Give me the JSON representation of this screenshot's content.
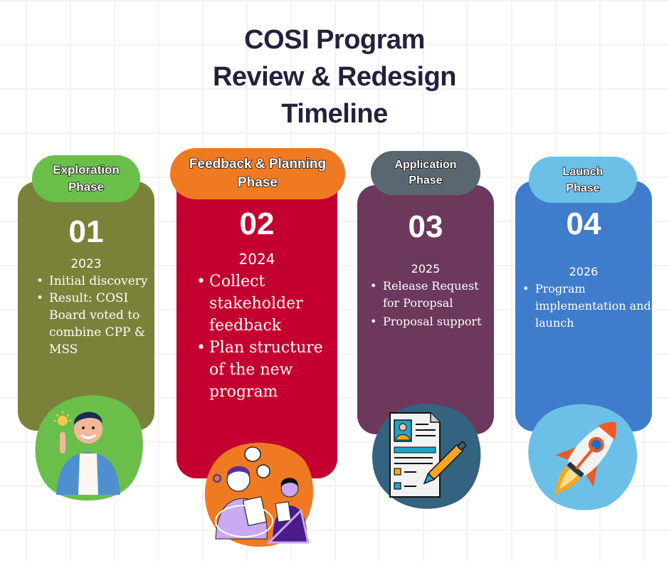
{
  "title": {
    "line1": "COSI Program",
    "line2": "Review & Redesign",
    "line3": "Timeline"
  },
  "phases": [
    {
      "pill_line1": "Exploration",
      "pill_line2": "Phase",
      "number": "01",
      "year": "2023",
      "bullets": [
        "Initial discovery",
        "Result: COSI Board voted to combine CPP & MSS"
      ],
      "card_color": "#7a823a",
      "pill_color": "#6abf4b",
      "illustration": "idea-person-icon"
    },
    {
      "pill_line1": "Feedback & Planning",
      "pill_line2": "Phase",
      "number": "02",
      "year": "2024",
      "bullets": [
        "Collect stakeholder feedback",
        "Plan structure of the new program"
      ],
      "card_color": "#c3002f",
      "pill_color": "#f07a22",
      "illustration": "discussion-people-icon"
    },
    {
      "pill_line1": "Application",
      "pill_line2": "Phase",
      "number": "03",
      "year": "2025",
      "bullets": [
        "Release Request for Poropsal",
        "Proposal support"
      ],
      "card_color": "#6c385c",
      "pill_color": "#5b6770",
      "illustration": "application-form-icon"
    },
    {
      "pill_line1": "Launch",
      "pill_line2": "Phase",
      "number": "04",
      "year": "2026",
      "bullets": [
        "Program implementation and launch"
      ],
      "card_color": "#3f7ccb",
      "pill_color": "#6cc0e8",
      "illustration": "rocket-icon"
    }
  ]
}
